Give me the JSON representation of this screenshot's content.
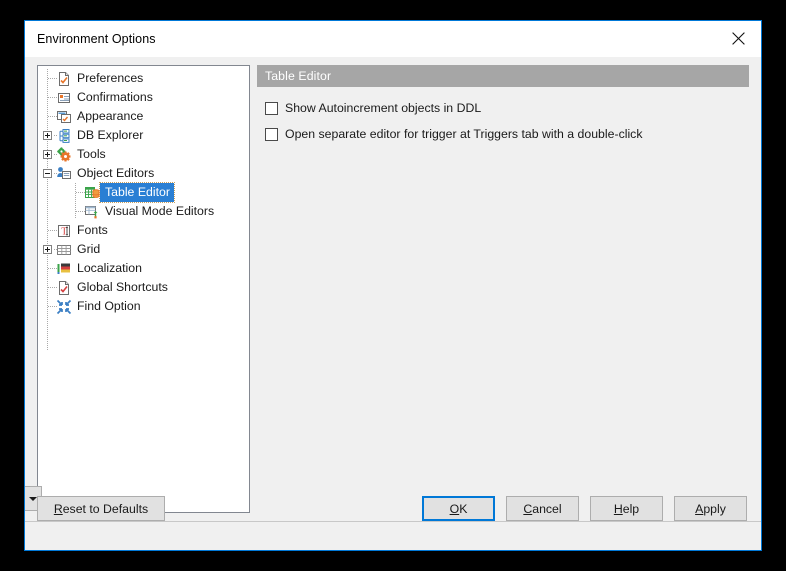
{
  "window": {
    "title": "Environment Options",
    "close_icon": "close-icon"
  },
  "tree": {
    "items": [
      {
        "label": "Preferences",
        "icon": "preferences-icon",
        "indent": 1,
        "expander": null
      },
      {
        "label": "Confirmations",
        "icon": "confirmations-icon",
        "indent": 1,
        "expander": null
      },
      {
        "label": "Appearance",
        "icon": "appearance-icon",
        "indent": 1,
        "expander": null
      },
      {
        "label": "DB Explorer",
        "icon": "db-explorer-icon",
        "indent": 1,
        "expander": "plus"
      },
      {
        "label": "Tools",
        "icon": "tools-icon",
        "indent": 1,
        "expander": "plus"
      },
      {
        "label": "Object Editors",
        "icon": "object-editors-icon",
        "indent": 1,
        "expander": "minus"
      },
      {
        "label": "Table Editor",
        "icon": "table-editor-icon",
        "indent": 2,
        "expander": null,
        "selected": true
      },
      {
        "label": "Visual Mode Editors",
        "icon": "visual-mode-editors-icon",
        "indent": 2,
        "expander": null
      },
      {
        "label": "Fonts",
        "icon": "fonts-icon",
        "indent": 1,
        "expander": null
      },
      {
        "label": "Grid",
        "icon": "grid-icon",
        "indent": 1,
        "expander": "plus"
      },
      {
        "label": "Localization",
        "icon": "localization-icon",
        "indent": 1,
        "expander": null
      },
      {
        "label": "Global Shortcuts",
        "icon": "global-shortcuts-icon",
        "indent": 1,
        "expander": null
      },
      {
        "label": "Find Option",
        "icon": "find-option-icon",
        "indent": 1,
        "expander": null
      }
    ]
  },
  "content": {
    "section_title": "Table Editor",
    "options": [
      {
        "label": "Show Autoincrement objects in DDL",
        "checked": false
      },
      {
        "label": "Open separate editor for trigger at Triggers tab with a double-click",
        "checked": false
      }
    ]
  },
  "footer": {
    "reset": {
      "pre": "R",
      "accel": "R",
      "label": "Reset to Defaults"
    },
    "ok": "OK",
    "cancel": "Cancel",
    "help": "Help",
    "apply": "Apply"
  },
  "colors": {
    "window_border": "#0078d7",
    "dialog_bg": "#f0f0f0",
    "section_header_bg": "#a6a6a6",
    "selection_bg": "#2a7fd4",
    "focus_ring": "#0078d7",
    "desktop_bg": "#000000"
  }
}
